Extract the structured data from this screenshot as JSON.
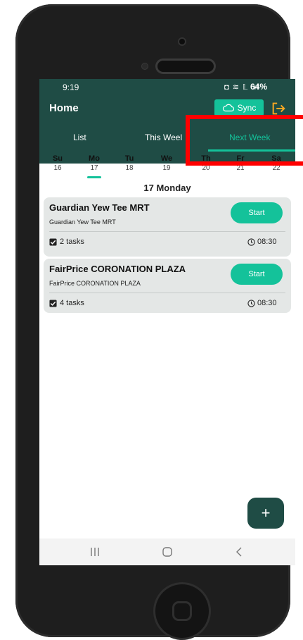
{
  "status_bar": {
    "time": "9:19",
    "icons": "◘ ≋ 𝕃 .ıl",
    "battery": "64%"
  },
  "header": {
    "title": "Home",
    "sync_label": "Sync"
  },
  "tabs": [
    {
      "label": "List"
    },
    {
      "label": "This Weel"
    },
    {
      "label": "Next Week"
    }
  ],
  "days": [
    {
      "name": "Su",
      "date": "16"
    },
    {
      "name": "Mo",
      "date": "17"
    },
    {
      "name": "Tu",
      "date": "18"
    },
    {
      "name": "We",
      "date": "19"
    },
    {
      "name": "Th",
      "date": "20"
    },
    {
      "name": "Fr",
      "date": "21"
    },
    {
      "name": "Sa",
      "date": "22"
    }
  ],
  "date_heading": "17 Monday",
  "visits": [
    {
      "name": "Guardian Yew Tee MRT",
      "subtitle": "Guardian Yew Tee MRT",
      "start_label": "Start",
      "tasks": "2 tasks",
      "time": "08:30"
    },
    {
      "name": "FairPrice CORONATION PLAZA",
      "subtitle": "FairPrice CORONATION PLAZA",
      "start_label": "Start",
      "tasks": "4 tasks",
      "time": "08:30"
    }
  ],
  "fab_label": "+",
  "colors": {
    "header_bg": "#1f4c45",
    "accent": "#14c29a",
    "logout": "#f5a623",
    "annotation": "#ff0000"
  }
}
